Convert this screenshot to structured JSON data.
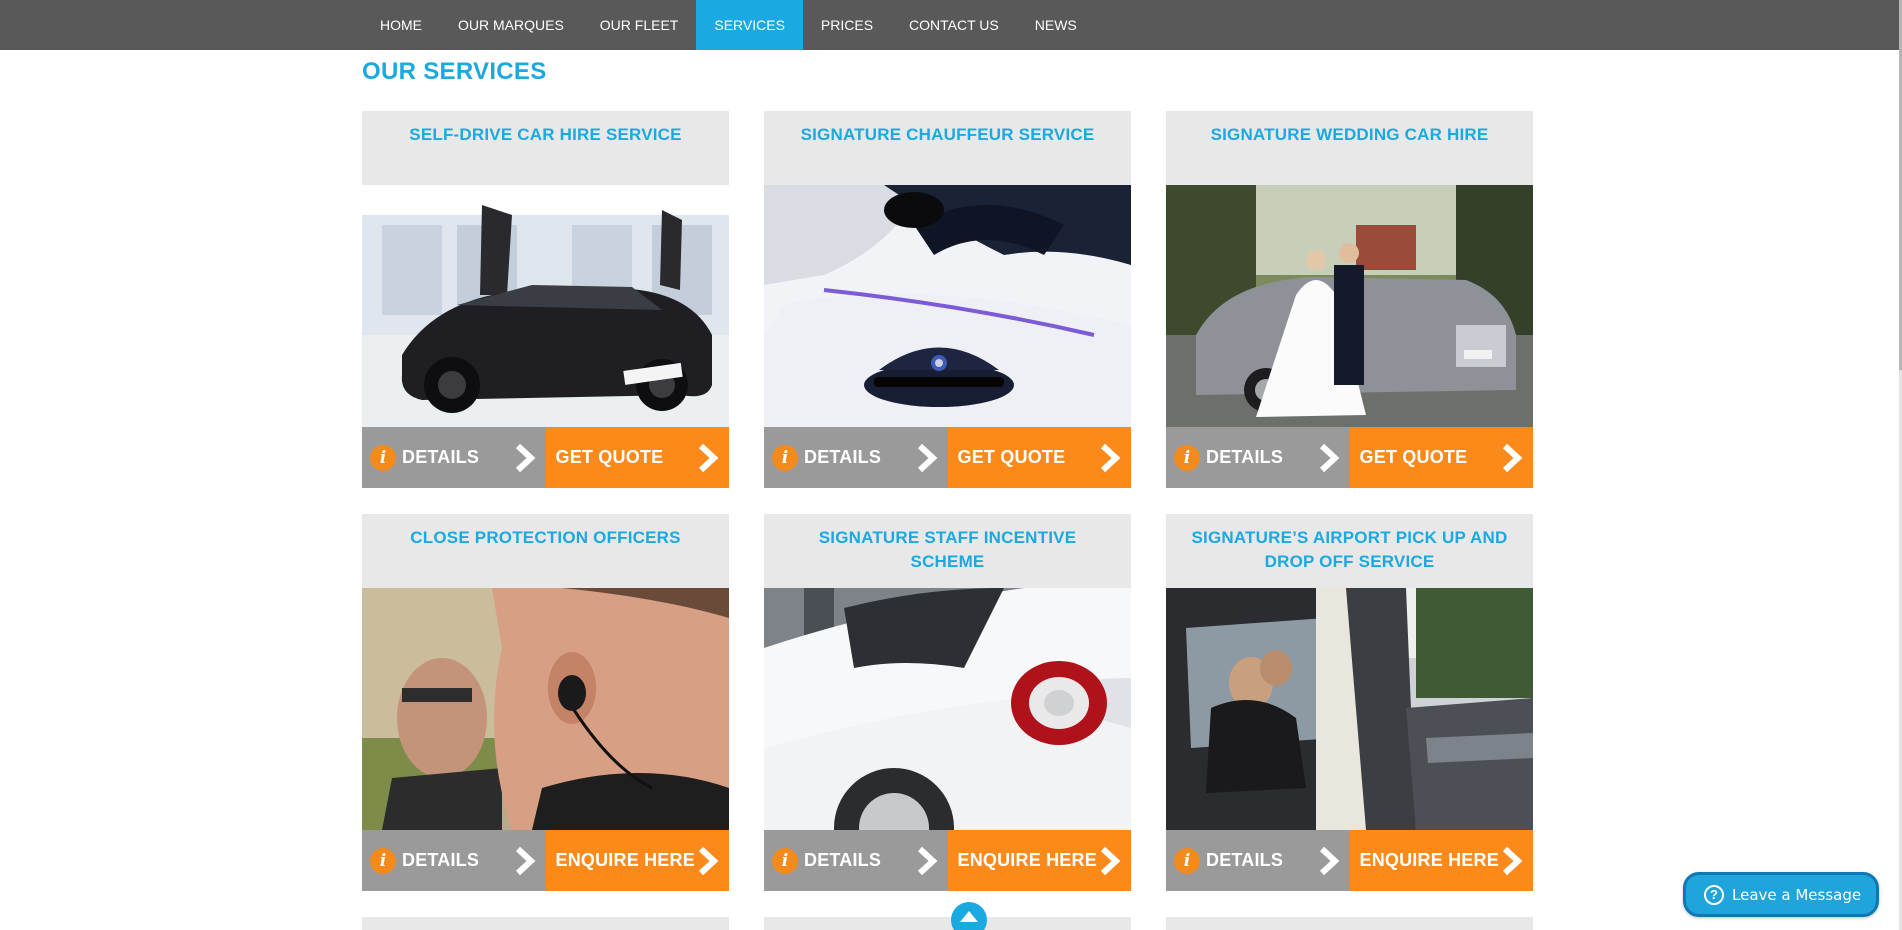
{
  "nav": {
    "items": [
      {
        "label": "HOME",
        "active": false
      },
      {
        "label": "OUR MARQUES",
        "active": false
      },
      {
        "label": "OUR FLEET",
        "active": false
      },
      {
        "label": "SERVICES",
        "active": true
      },
      {
        "label": "PRICES",
        "active": false
      },
      {
        "label": "CONTACT US",
        "active": false
      },
      {
        "label": "NEWS",
        "active": false
      }
    ]
  },
  "page": {
    "title": "OUR SERVICES"
  },
  "services": [
    {
      "title": "SELF-DRIVE CAR HIRE SERVICE",
      "image": "black supercar with scissor doors in showroom",
      "details_label": "DETAILS",
      "action_label": "GET QUOTE"
    },
    {
      "title": "SIGNATURE CHAUFFEUR SERVICE",
      "image": "chauffeur cap on white leather seat",
      "details_label": "DETAILS",
      "action_label": "GET QUOTE"
    },
    {
      "title": "SIGNATURE WEDDING CAR HIRE",
      "image": "bride and groom beside silver luxury car",
      "details_label": "DETAILS",
      "action_label": "GET QUOTE"
    },
    {
      "title": "CLOSE PROTECTION OFFICERS",
      "image": "security officer with earpiece",
      "details_label": "DETAILS",
      "action_label": "ENQUIRE HERE"
    },
    {
      "title": "SIGNATURE STAFF INCENTIVE SCHEME",
      "image": "white sports car rear light",
      "details_label": "DETAILS",
      "action_label": "ENQUIRE HERE"
    },
    {
      "title": "SIGNATURE’S AIRPORT PICK UP AND DROP OFF SERVICE",
      "image": "passenger in rear seat of grey limousine",
      "details_label": "DETAILS",
      "action_label": "ENQUIRE HERE"
    }
  ],
  "chat": {
    "label": "Leave a Message",
    "icon": "question-icon"
  },
  "icons": {
    "info": "info-icon",
    "chevron": "chevron-right-icon",
    "scroll_top": "arrow-up-icon"
  },
  "colors": {
    "accent": "#1aa9e1",
    "nav_bg": "#595959",
    "details_bg": "#9a9a9a",
    "quote_bg": "#fb8a1a",
    "card_bg": "#e8e8e8"
  }
}
